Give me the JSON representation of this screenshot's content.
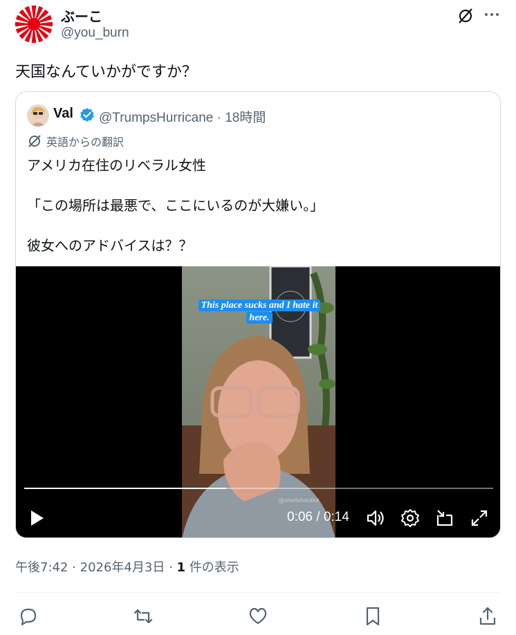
{
  "author": {
    "display_name": "ぶーこ",
    "handle": "@you_burn",
    "avatar_icon": "rising-sun-flag-icon"
  },
  "tweet_text": "天国なんていかがですか？",
  "quote": {
    "display_name": "Val",
    "handle": "@TrumpsHurricane",
    "separator": "·",
    "time": "18時間",
    "translation_label": "英語からの翻訳",
    "lines": [
      "アメリカ在住のリベラル女性",
      "「この場所は最悪で、ここにいるのが大嫌い。」",
      "彼女へのアドバイスは？？"
    ],
    "video": {
      "caption": "This place sucks and I hate it here.",
      "watermark": "@shellshockkk",
      "current_time": "0:06",
      "total_time": "0:14",
      "time_display": "0:06 / 0:14",
      "progress": 0.43
    }
  },
  "meta": {
    "time": "午後7:42",
    "date": "2026年4月3日",
    "views_count": "1",
    "views_label": "件の表示",
    "separator": "·"
  },
  "colors": {
    "accent": "#1d9bf0",
    "secondary_text": "#536471",
    "border": "#cfd9de",
    "flag_red": "#e60012"
  }
}
